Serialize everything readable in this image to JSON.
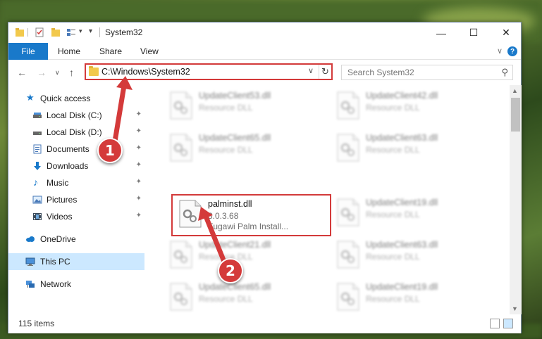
{
  "window": {
    "title": "System32",
    "buttons": {
      "minimize": "—",
      "maximize": "☐",
      "close": "✕"
    }
  },
  "ribbon": {
    "tabs": [
      "File",
      "Home",
      "Share",
      "View"
    ],
    "expand_glyph": "∨",
    "help_glyph": "?"
  },
  "nav": {
    "back": "←",
    "forward": "→",
    "recent": "∨",
    "up": "↑",
    "address": "C:\\Windows\\System32",
    "address_dropdown": "∨",
    "refresh": "↻",
    "search_placeholder": "Search System32",
    "search_glyph": "⚲"
  },
  "sidebar": {
    "quick_access": "Quick access",
    "pinned": [
      {
        "label": "Local Disk (C:)",
        "icon": "drive-icon"
      },
      {
        "label": "Local Disk (D:)",
        "icon": "drive-icon"
      },
      {
        "label": "Documents",
        "icon": "documents-icon"
      },
      {
        "label": "Downloads",
        "icon": "downloads-icon"
      },
      {
        "label": "Music",
        "icon": "music-icon"
      },
      {
        "label": "Pictures",
        "icon": "pictures-icon"
      },
      {
        "label": "Videos",
        "icon": "videos-icon"
      }
    ],
    "pin_glyph": "📌",
    "onedrive": "OneDrive",
    "this_pc": "This PC",
    "network": "Network"
  },
  "files": {
    "left": [
      {
        "name": "UpdateClient53.dll",
        "sub1": "Resource DLL"
      },
      {
        "name": "UpdateClient65.dll",
        "sub1": "Resource DLL"
      },
      {
        "name": "palminst.dll",
        "sub1": "3.0.3.68",
        "sub2": "Fugawi Palm Install..."
      },
      {
        "name": "UpdateClient21.dll",
        "sub1": "Resource DLL"
      },
      {
        "name": "UpdateClient65.dll",
        "sub1": "Resource DLL"
      }
    ],
    "right": [
      {
        "name": "UpdateClient42.dll",
        "sub1": "Resource DLL"
      },
      {
        "name": "UpdateClient63.dll",
        "sub1": "Resource DLL"
      },
      {
        "name": "UpdateClient19.dll",
        "sub1": "Resource DLL"
      },
      {
        "name": "UpdateClient63.dll",
        "sub1": "Resource DLL"
      },
      {
        "name": "UpdateClient19.dll",
        "sub1": "Resource DLL"
      }
    ]
  },
  "status": {
    "count": "115 items"
  },
  "callouts": {
    "one": "1",
    "two": "2"
  },
  "colors": {
    "accent": "#1979ca",
    "highlight": "#d33a3a",
    "selected": "#cce8ff"
  }
}
